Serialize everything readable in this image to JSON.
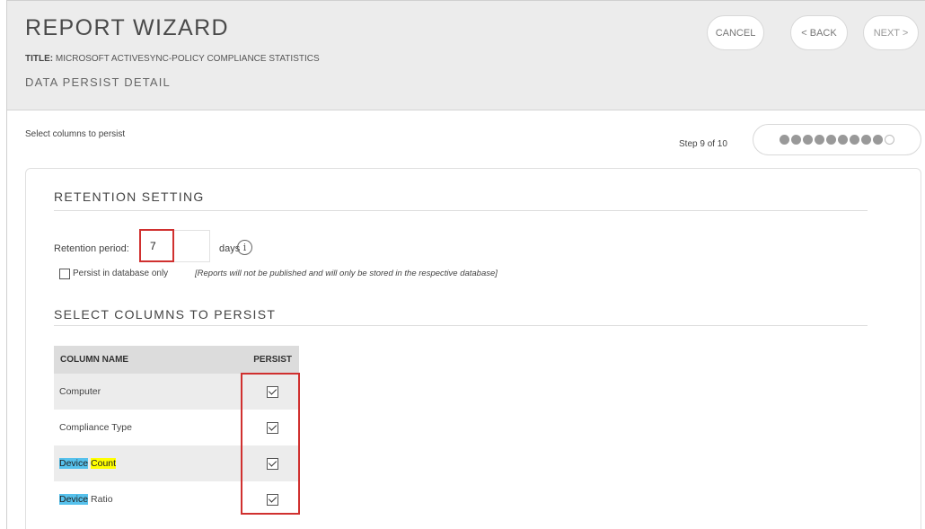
{
  "header": {
    "wizard_title": "REPORT WIZARD",
    "title_label": "TITLE:",
    "title_value": "MICROSOFT ACTIVESYNC-POLICY COMPLIANCE STATISTICS",
    "subtitle": "DATA PERSIST DETAIL",
    "buttons": {
      "cancel": "CANCEL",
      "back": "< BACK",
      "next": "NEXT >"
    }
  },
  "step": {
    "instruction": "Select columns to persist",
    "label": "Step 9 of 10",
    "current": 9,
    "total": 10
  },
  "retention": {
    "heading": "RETENTION SETTING",
    "period_label": "Retention period:",
    "period_value": "7",
    "unit": "days",
    "info_icon": "i",
    "persist_db_label": "Persist in database only",
    "persist_db_checked": false,
    "persist_db_note": "[Reports will not be published and will only be stored in the respective database]"
  },
  "columns": {
    "heading": "SELECT COLUMNS TO PERSIST",
    "header_name": "COLUMN NAME",
    "header_persist": "PERSIST",
    "rows": [
      {
        "name": "Computer",
        "persist": true
      },
      {
        "name": "Compliance Type",
        "persist": true
      },
      {
        "name_part1": "Device",
        "name_part2": "Count",
        "persist": true
      },
      {
        "name_part1": "Device",
        "name_part2": "Ratio",
        "persist": true
      }
    ]
  },
  "colors": {
    "header_bg": "#ececec",
    "highlight_red": "#d0302f",
    "search_hl_blue": "#56c1ec",
    "search_hl_yellow": "#ffff00",
    "table_header_bg": "#dcdcdc"
  }
}
